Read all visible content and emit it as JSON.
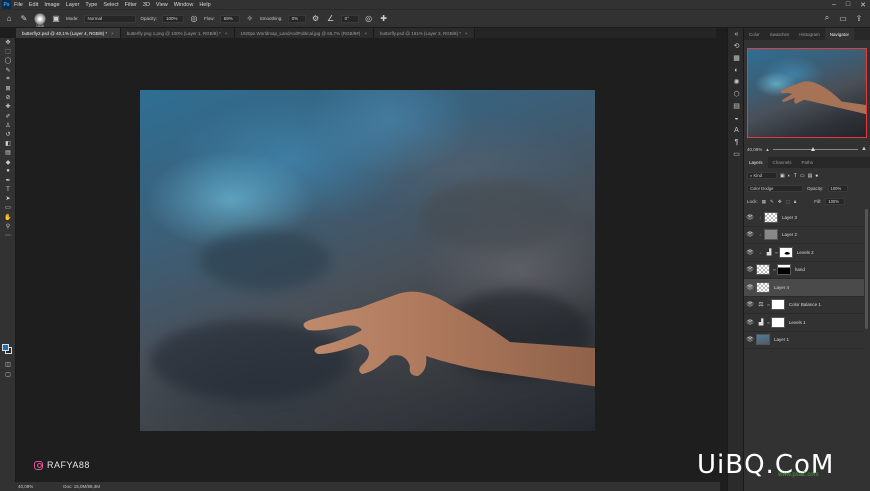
{
  "app": {
    "logo": "Ps"
  },
  "menu": [
    "File",
    "Edit",
    "Image",
    "Layer",
    "Type",
    "Select",
    "Filter",
    "3D",
    "View",
    "Window",
    "Help"
  ],
  "window_controls": {
    "minimize": "–",
    "maximize": "□",
    "close": "✕"
  },
  "options_bar": {
    "brush_size": "1536",
    "mode_label": "Mode:",
    "mode_value": "Normal",
    "opacity_label": "Opacity:",
    "opacity_value": "100%",
    "flow_label": "Flow:",
    "flow_value": "69%",
    "smoothing_label": "Smoothing:",
    "smoothing_value": "0%",
    "angle_value": "0°"
  },
  "tabs": [
    {
      "label": "butterfly2.psd @ 40,1% (Layer 4, RGB/8) *",
      "active": true
    },
    {
      "label": "butterfly png 1.png @ 100% (Layer 1, RGB/8) *",
      "active": false
    },
    {
      "label": "1920px Worldmap_LandAndPolitical.jpg @ 66,7% (RGB/8#)",
      "active": false
    },
    {
      "label": "butterfly.psd @ 191% (Layer 3, RGB/8) *",
      "active": false
    }
  ],
  "tab_close": "×",
  "status_bar": {
    "zoom": "40,09%",
    "doc": "Doc: 15,0M/88,3M"
  },
  "watermark": {
    "handle": "RAFYA88",
    "site": "UiBQ.CoM",
    "site_sub": "www.psaZ.com"
  },
  "panels": {
    "top_tabs": [
      "Color",
      "Swatches",
      "Histogram",
      "Navigator"
    ],
    "active_top_tab": "Navigator",
    "nav_zoom": "40,09%",
    "layers_tabs": [
      "Layers",
      "Channels",
      "Paths"
    ],
    "filter_kind": "Kind",
    "blend_mode": "Color Dodge",
    "opacity_label": "Opacity:",
    "opacity_value": "100%",
    "lock_label": "Lock:",
    "fill_label": "Fill:",
    "fill_value": "100%"
  },
  "layers": [
    {
      "name": "Layer 3",
      "thumb": "checker",
      "type": "pixel",
      "clipped": true,
      "selected": false
    },
    {
      "name": "Layer 2",
      "thumb": "checker",
      "type": "pixel",
      "clipped": true,
      "selected": false
    },
    {
      "name": "Levels 2",
      "thumb": "mask",
      "type": "adjustment",
      "clipped": true,
      "selected": false
    },
    {
      "name": "hand",
      "thumb": "black",
      "type": "masked",
      "clipped": false,
      "selected": false
    },
    {
      "name": "Layer 4",
      "thumb": "checker",
      "type": "pixel",
      "clipped": false,
      "selected": true
    },
    {
      "name": "Color Balance 1",
      "thumb": "white",
      "type": "adjustment",
      "clipped": false,
      "selected": false
    },
    {
      "name": "Levels 1",
      "thumb": "white",
      "type": "adjustment",
      "clipped": false,
      "selected": false
    },
    {
      "name": "Layer 1",
      "thumb": "sky",
      "type": "pixel",
      "clipped": false,
      "selected": false
    }
  ],
  "colors": {
    "foreground": "#1d6fb8",
    "navigator_frame": "#e23b3b"
  }
}
